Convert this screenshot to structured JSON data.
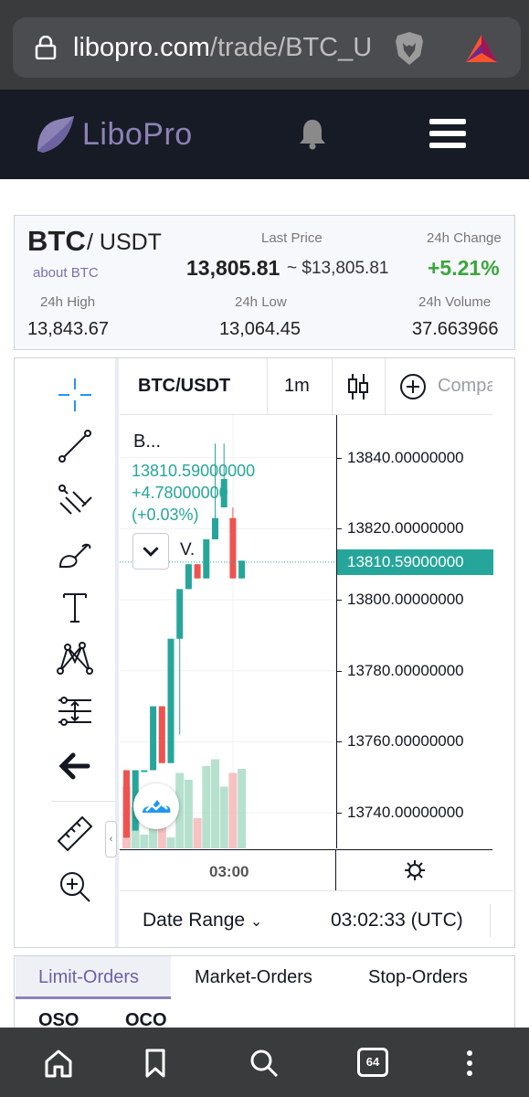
{
  "browser": {
    "url_host": "libopro.com",
    "url_path": "/trade/BTC_U",
    "tab_count": "64"
  },
  "site": {
    "logo_text": "LiboPro"
  },
  "ticker": {
    "base": "BTC",
    "quote": "/ USDT",
    "about_link": "about BTC",
    "last_price_label": "Last Price",
    "last_price": "13,805.81",
    "last_price_usd": "~ $13,805.81",
    "change_label": "24h Change",
    "change": "+5.21%",
    "high_label": "24h High",
    "high": "13,843.67",
    "low_label": "24h Low",
    "low": "13,064.45",
    "volume_label": "24h Volume",
    "volume": "37.663966"
  },
  "chart_toolbar": {
    "tools": [
      "crosshair-icon",
      "trend-line-icon",
      "pitchfork-icon",
      "brush-icon",
      "text-icon",
      "pattern-icon",
      "measure-icon",
      "arrow-left-icon",
      "ruler-icon",
      "zoom-in-icon"
    ]
  },
  "chart_header": {
    "symbol": "BTC/USDT",
    "interval": "1m",
    "compare": "Compare"
  },
  "legend": {
    "title": "B...",
    "price": "13810.59000000",
    "change": "+4.78000000",
    "change_pct": "(+0.03%)",
    "volume_short": "V."
  },
  "bottom_bar": {
    "date_range": "Date Range",
    "clock": "03:02:33 (UTC)"
  },
  "colors": {
    "up": "#26a69a",
    "down": "#ef5350",
    "accent": "#8d82b5",
    "change_positive": "#3aa63a"
  },
  "chart_data": {
    "type": "candlestick",
    "x_tick_labels": [
      "03:00"
    ],
    "y_tick_labels": [
      "13840.00000000",
      "13820.00000000",
      "13800.00000000",
      "13780.00000000",
      "13760.00000000",
      "13740.00000000"
    ],
    "ylim": [
      13730,
      13852
    ],
    "current_price_label": "13810.59000000",
    "candles": [
      {
        "o": 13752,
        "h": 13752,
        "l": 13733,
        "c": 13733
      },
      {
        "o": 13735,
        "h": 13752,
        "l": 13735,
        "c": 13752
      },
      {
        "o": 13752,
        "h": 13752,
        "l": 13752,
        "c": 13752
      },
      {
        "o": 13752,
        "h": 13770,
        "l": 13752,
        "c": 13770
      },
      {
        "o": 13770,
        "h": 13770,
        "l": 13754,
        "c": 13754
      },
      {
        "o": 13754,
        "h": 13789,
        "l": 13754,
        "c": 13789
      },
      {
        "o": 13789,
        "h": 13803,
        "l": 13762,
        "c": 13803
      },
      {
        "o": 13803,
        "h": 13810,
        "l": 13803,
        "c": 13810
      },
      {
        "o": 13810,
        "h": 13810,
        "l": 13806,
        "c": 13806
      },
      {
        "o": 13806,
        "h": 13817,
        "l": 13806,
        "c": 13817
      },
      {
        "o": 13817,
        "h": 13844,
        "l": 13817,
        "c": 13823
      },
      {
        "o": 13826,
        "h": 13844,
        "l": 13826,
        "c": 13834
      },
      {
        "o": 13823,
        "h": 13826,
        "l": 13806,
        "c": 13806
      },
      {
        "o": 13806,
        "h": 13811,
        "l": 13806,
        "c": 13811
      }
    ],
    "volumes": [
      0.45,
      0.3,
      0.1,
      0.35,
      0.42,
      0.08,
      0.55,
      0.5,
      0.22,
      0.6,
      0.65,
      0.45,
      0.55,
      0.58
    ]
  }
}
